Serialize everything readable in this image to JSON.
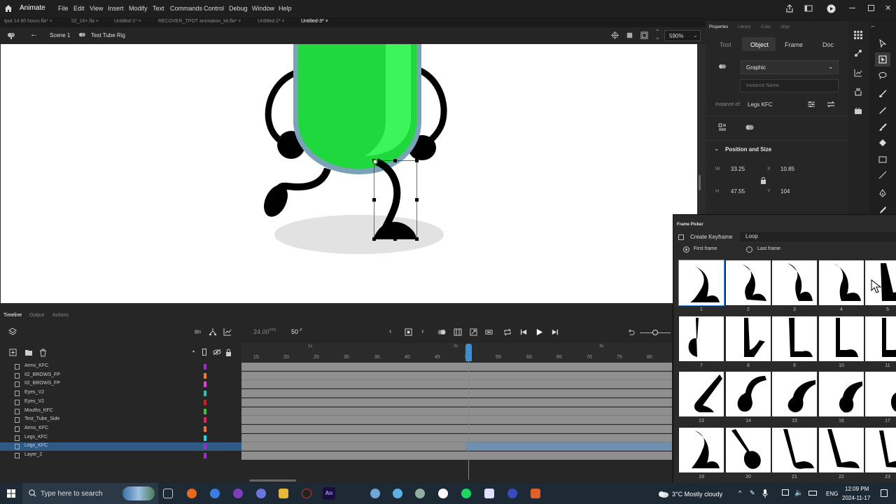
{
  "menubar": {
    "app_name": "Animate",
    "menus": [
      "File",
      "Edit",
      "View",
      "Insert",
      "Modify",
      "Text",
      "Commands",
      "Control",
      "Debug",
      "Window",
      "Help"
    ]
  },
  "doc_tabs": [
    "tpot 14 80 hours.fla*",
    "II2_16+.fla",
    "Untitled-1*",
    "RECOVER_TPOT animation_kit.fla*",
    "Untitled-2*",
    "Untitled-3*"
  ],
  "active_tab_index": 5,
  "editbar": {
    "scene": "Scene 1",
    "symbol": "Test Tube Rig",
    "zoom": "590%"
  },
  "properties": {
    "panel_tabs": [
      "Properties",
      "Library",
      "Color",
      "Align"
    ],
    "sub_tabs": [
      "Tool",
      "Object",
      "Frame",
      "Doc"
    ],
    "symbol_type": "Graphic",
    "instance_placeholder": "Instance Name",
    "instance_of_label": "Instance of:",
    "instance_of_value": "Legs KFC",
    "section": "Position and Size",
    "w_label": "W",
    "w": "33.25",
    "h_label": "H",
    "h": "47.55",
    "x_label": "X",
    "x": "10.85",
    "y_label": "Y",
    "y": "104"
  },
  "timeline": {
    "tabs": [
      "Timeline",
      "Output",
      "Actions"
    ],
    "fps": "24.00",
    "fps_unit": "FPS",
    "frame": "50",
    "frame_unit": "F",
    "seconds": [
      "1s",
      "2s",
      "3s"
    ],
    "ruler": [
      "15",
      "20",
      "25",
      "30",
      "35",
      "40",
      "45",
      "50",
      "55",
      "60",
      "65",
      "70",
      "75",
      "80"
    ],
    "layers": [
      {
        "name": "Arms_KFC",
        "color": "#9c2fc6"
      },
      {
        "name": "II2_BROWS_FP",
        "color": "#f07d2a"
      },
      {
        "name": "II2_BROWS_FP",
        "color": "#e43fd7"
      },
      {
        "name": "Eyes_V2",
        "color": "#2cc3b7"
      },
      {
        "name": "Eyes_V2",
        "color": "#c8202a"
      },
      {
        "name": "Mouths_KFC",
        "color": "#4bbf3a"
      },
      {
        "name": "Test_Tube_Side",
        "color": "#d6256b"
      },
      {
        "name": "Arms_KFC",
        "color": "#f0742a"
      },
      {
        "name": "Legs_KFC",
        "color": "#22d7e6"
      },
      {
        "name": "Legs_KFC",
        "color": "#9c2fc6"
      },
      {
        "name": "Layer_2",
        "color": "#9c2fc6"
      }
    ],
    "selected_layer_index": 9
  },
  "frame_picker": {
    "title": "Frame Picker",
    "create_keyframe": "Create Keyframe",
    "loop": "Loop",
    "first_frame": "First frame",
    "last_frame": "Last frame",
    "frames": [
      "1",
      "2",
      "3",
      "4",
      "5",
      "7",
      "8",
      "9",
      "10",
      "11",
      "13",
      "14",
      "15",
      "16",
      "17",
      "19",
      "20",
      "21",
      "22",
      "23"
    ]
  },
  "taskbar": {
    "search_placeholder": "Type here to search",
    "weather": "3°C  Mostly cloudy",
    "lang": "ENG",
    "time": "12:09 PM",
    "date": "2024-11-17"
  },
  "colors": {
    "tube_green": "#2be84a",
    "tube_outline": "#7aa3b8",
    "selection": "#2f5a86"
  }
}
